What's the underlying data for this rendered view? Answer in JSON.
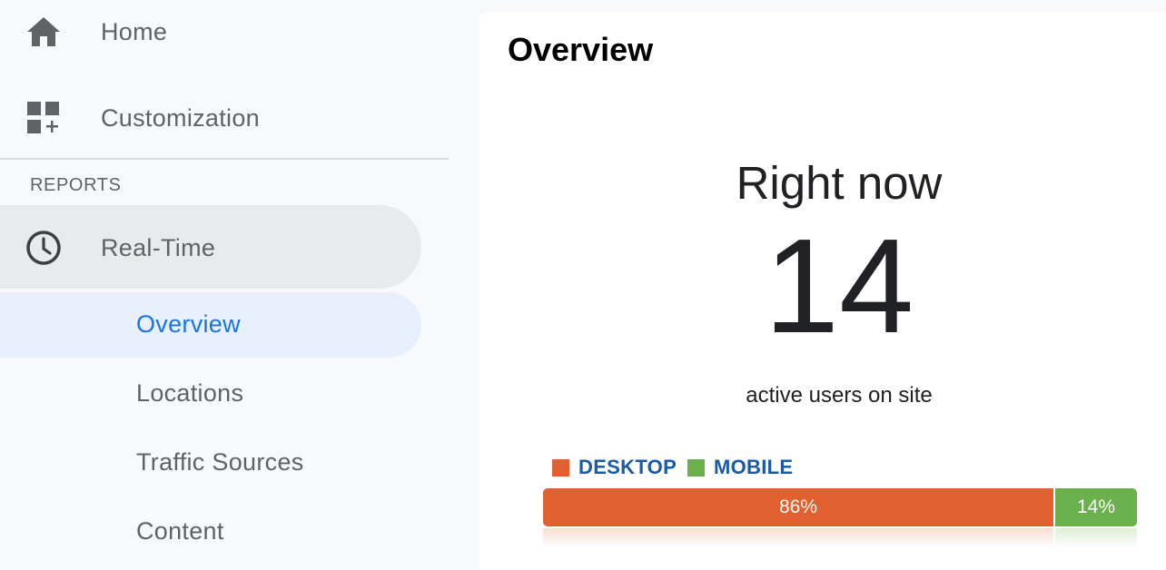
{
  "sidebar": {
    "home_label": "Home",
    "customization_label": "Customization",
    "reports_heading": "REPORTS",
    "realtime_label": "Real-Time",
    "subitems": {
      "overview": "Overview",
      "locations": "Locations",
      "traffic_sources": "Traffic Sources",
      "content": "Content"
    },
    "icons": {
      "home": "home-icon",
      "customization": "dashboard-add-icon",
      "realtime": "clock-icon"
    }
  },
  "main": {
    "title": "Overview",
    "right_now_label": "Right now",
    "active_users_count": "14",
    "active_users_label": "active users on site"
  },
  "device_split": {
    "legend": {
      "desktop_label": "DESKTOP",
      "mobile_label": "MOBILE"
    },
    "desktop_fraction": 0.86,
    "mobile_fraction": 0.14,
    "desktop_text": "86%",
    "mobile_text": "14%"
  },
  "colors": {
    "desktop": "#e0602f",
    "mobile": "#6ab04c",
    "active_nav_bg": "#e8f0fe",
    "active_nav_text": "#1a73e8",
    "legend_text": "#1a5aa6"
  }
}
